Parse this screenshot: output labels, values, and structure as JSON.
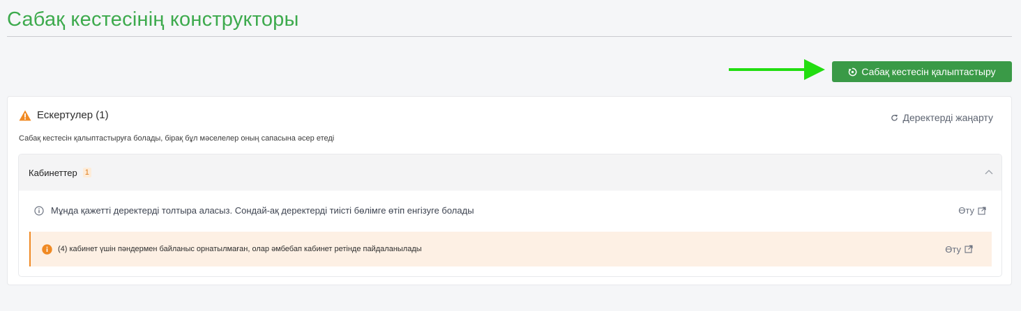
{
  "page": {
    "title": "Сабақ кестесінің конструкторы"
  },
  "toolbar": {
    "generate_label": "Сабақ кестесін қалыптастыру"
  },
  "warnings": {
    "title": "Ескертулер (1)",
    "refresh_label": "Деректерді жаңарту",
    "description": "Сабақ кестесін қалыптастыруға болады, бірақ бұл мәселелер оның сапасына әсер етеді",
    "panel": {
      "name": "Кабинеттер",
      "count": "1",
      "info_text": "Мұнда қажетті деректерді толтыра аласыз. Сондай-ақ деректерді тиісті бөлімге өтіп енгізуге болады",
      "info_link": "Өту",
      "alert_text": "(4) кабинет үшін пәндермен байланыс орнатылмаған, олар әмбебап кабинет ретінде пайдаланылады",
      "alert_link": "Өту"
    }
  },
  "colors": {
    "accent": "#3daa4d",
    "button": "#3a9a47",
    "warning": "#f08a24",
    "alert_bg": "#fdf0e4",
    "arrow": "#22dd11"
  },
  "icons": {
    "warning": "warning-triangle-icon",
    "refresh": "refresh-icon",
    "info": "info-circle-icon",
    "alert": "alert-circle-icon",
    "external": "external-link-icon",
    "chevron": "chevron-up-icon",
    "generate": "generate-icon"
  }
}
